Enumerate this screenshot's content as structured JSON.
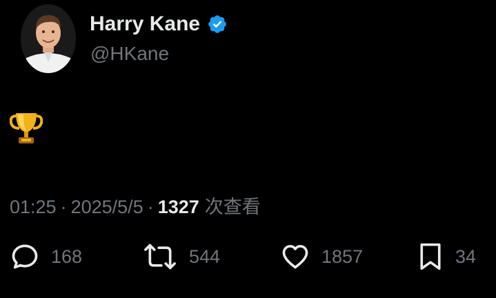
{
  "profile": {
    "display_name": "Harry Kane",
    "handle": "@HKane",
    "verified": true,
    "verified_color": "#1d9bf0"
  },
  "tweet": {
    "content_icon": "trophy-icon",
    "time": "01:25",
    "separator": "·",
    "date": "2025/5/5",
    "views_count": "1327",
    "views_label": "次查看"
  },
  "actions": {
    "replies": "168",
    "retweets": "544",
    "likes": "1857",
    "bookmarks": "34"
  },
  "colors": {
    "background": "#000000",
    "primary_text": "#e7e9ea",
    "secondary_text": "#71767b",
    "trophy_gold": "#f2b21a"
  }
}
